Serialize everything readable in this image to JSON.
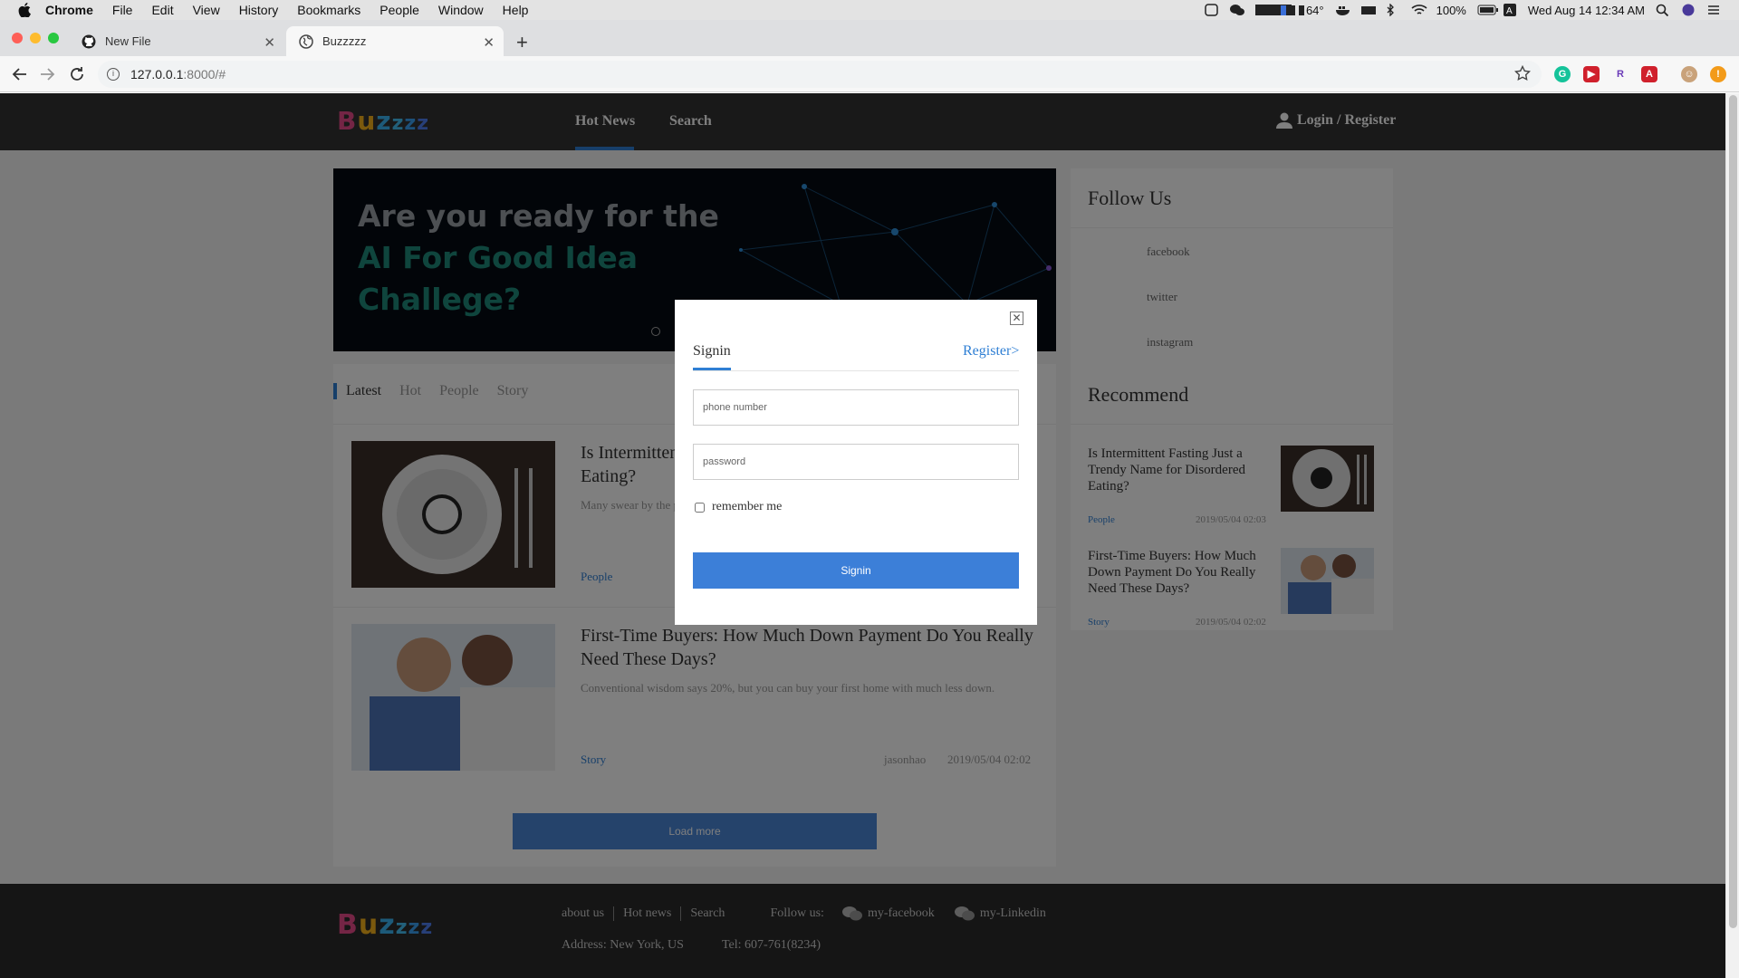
{
  "menubar": {
    "items": [
      "Chrome",
      "File",
      "Edit",
      "View",
      "History",
      "Bookmarks",
      "People",
      "Window",
      "Help"
    ],
    "temperature": "64°",
    "battery": "100%",
    "clock": "Wed Aug 14  12:34 AM"
  },
  "browser": {
    "tabs": [
      {
        "title": "New File",
        "icon": "github-icon"
      },
      {
        "title": "Buzzzzz",
        "icon": "globe-icon"
      }
    ],
    "url_host": "127.0.0.1",
    "url_path": ":8000/#"
  },
  "site": {
    "logo": [
      "B",
      "u",
      "z",
      "z",
      "z",
      "z"
    ],
    "nav": {
      "hot_news": "Hot News",
      "search": "Search"
    },
    "login": "Login / Register",
    "banner": {
      "line1": "Are you ready for the",
      "line2": "AI For Good Idea",
      "line3": "Challege?"
    },
    "tabs": [
      "Latest",
      "Hot",
      "People",
      "Story"
    ],
    "articles": [
      {
        "title": "Is Intermittent Fasting Just a Trendy Name for Disordered Eating?",
        "desc": "Many swear by the practice of restricting when they eat. Others say it's a bluff.",
        "category": "People",
        "author": "",
        "date": ""
      },
      {
        "title": "First-Time Buyers: How Much Down Payment Do You Really Need These Days?",
        "desc": "Conventional wisdom says 20%, but you can buy your first home with much less down.",
        "category": "Story",
        "author": "jasonhao",
        "date": "2019/05/04 02:02"
      }
    ],
    "load_more": "Load more",
    "sidebar": {
      "follow_title": "Follow Us",
      "follow_items": [
        "facebook",
        "twitter",
        "instagram"
      ],
      "recommend_title": "Recommend",
      "recommend": [
        {
          "title": "Is Intermittent Fasting Just a Trendy Name for Disordered Eating?",
          "category": "People",
          "date": "2019/05/04 02:03"
        },
        {
          "title": "First-Time Buyers: How Much Down Payment Do You Really Need These Days?",
          "category": "Story",
          "date": "2019/05/04 02:02"
        }
      ]
    },
    "footer": {
      "links": [
        "about us",
        "Hot news",
        "Search"
      ],
      "follow_label": "Follow us:",
      "social": [
        "my-facebook",
        "my-Linkedin"
      ],
      "address": "Address: New York, US",
      "tel": "Tel: 607-761(8234)"
    }
  },
  "modal": {
    "tab_signin": "Signin",
    "tab_register": "Register>",
    "phone_placeholder": "phone number",
    "password_placeholder": "password",
    "remember": "remember me",
    "button": "Signin"
  },
  "colors": {
    "accent": "#2f7fd4",
    "header": "#333333",
    "button": "#3c7fd8"
  }
}
